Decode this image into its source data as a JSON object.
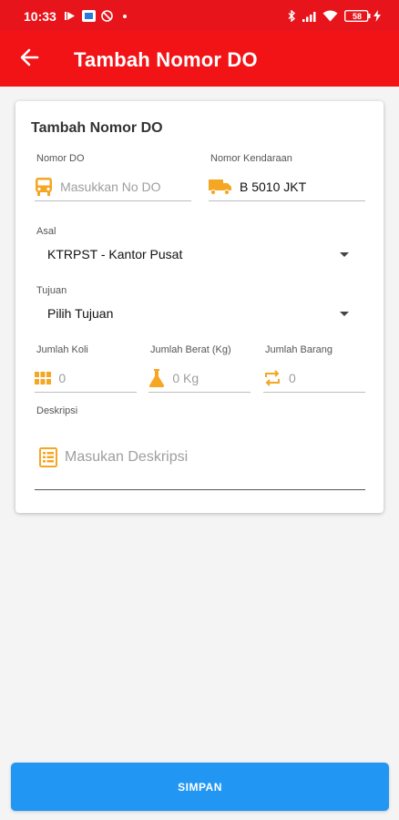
{
  "status_bar": {
    "time": "10:33",
    "battery_level": "58"
  },
  "app_bar": {
    "title": "Tambah Nomor DO"
  },
  "form": {
    "title": "Tambah Nomor DO",
    "nomor_do": {
      "label": "Nomor DO",
      "placeholder": "Masukkan No DO",
      "value": ""
    },
    "nomor_kendaraan": {
      "label": "Nomor Kendaraan",
      "value": "B 5010 JKT"
    },
    "asal": {
      "label": "Asal",
      "selected": "KTRPST - Kantor Pusat"
    },
    "tujuan": {
      "label": "Tujuan",
      "selected": "Pilih Tujuan"
    },
    "jumlah_koli": {
      "label": "Jumlah Koli",
      "placeholder": "0"
    },
    "jumlah_berat": {
      "label": "Jumlah Berat (Kg)",
      "placeholder": "0 Kg"
    },
    "jumlah_barang": {
      "label": "Jumlah Barang",
      "placeholder": "0"
    },
    "deskripsi": {
      "label": "Deskripsi",
      "placeholder": "Masukan Deskripsi"
    }
  },
  "actions": {
    "save_label": "SIMPAN"
  },
  "colors": {
    "header": "#f21317",
    "status_bar": "#e8141b",
    "icon_accent": "#f5a623",
    "primary_button": "#2196f3"
  }
}
